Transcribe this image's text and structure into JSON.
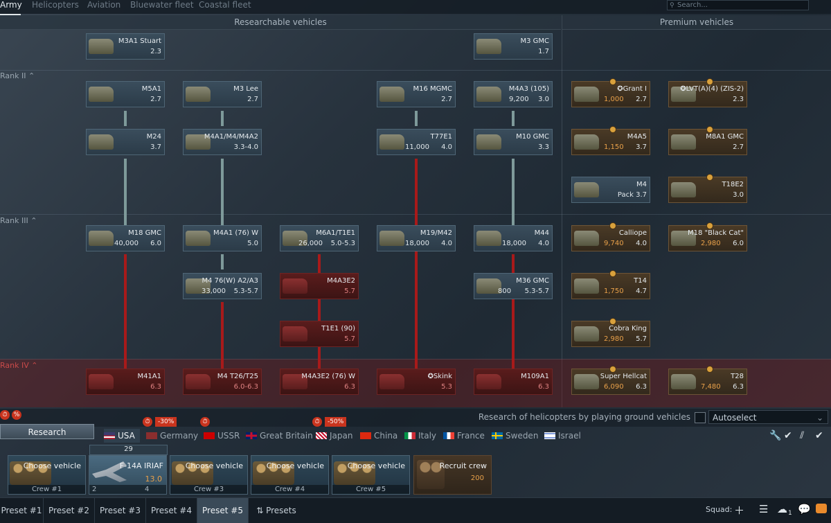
{
  "tabs": [
    "Army",
    "Helicopters",
    "Aviation",
    "Bluewater fleet",
    "Coastal fleet"
  ],
  "search_placeholder": "Search...",
  "sections": {
    "researchable": "Researchable vehicles",
    "premium": "Premium vehicles"
  },
  "ranks": [
    "Rank II",
    "Rank III",
    "Rank IV"
  ],
  "vehicles": {
    "m3a1": {
      "name": "M3A1 Stuart",
      "br": "2.3"
    },
    "m3gmc": {
      "name": "M3 GMC",
      "br": "1.7"
    },
    "m5a1": {
      "name": "M5A1",
      "br": "2.7"
    },
    "m3lee": {
      "name": "M3 Lee",
      "br": "2.7"
    },
    "m16": {
      "name": "M16 MGMC",
      "br": "2.7"
    },
    "m4a3105": {
      "name": "M4A3 (105)",
      "cost": "9,200",
      "br": "3.0"
    },
    "m24": {
      "name": "M24",
      "br": "3.7"
    },
    "m4a1": {
      "name": "M4A1/M4/M4A2",
      "br": "3.3-4.0"
    },
    "t77e1": {
      "name": "T77E1",
      "cost": "11,000",
      "br": "4.0"
    },
    "m10": {
      "name": "M10 GMC",
      "br": "3.3"
    },
    "m18": {
      "name": "M18 GMC",
      "cost": "40,000",
      "br": "6.0"
    },
    "m4a176": {
      "name": "M4A1 (76) W",
      "br": "5.0"
    },
    "m6a1": {
      "name": "M6A1/T1E1",
      "cost": "26,000",
      "br": "5.0-5.3"
    },
    "m19": {
      "name": "M19/M42",
      "cost": "18,000",
      "br": "4.0"
    },
    "m44": {
      "name": "M44",
      "cost": "18,000",
      "br": "4.0"
    },
    "m476w": {
      "name": "M4 76(W) A2/A3",
      "cost": "33,000",
      "br": "5.3-5.7"
    },
    "m4a3e2": {
      "name": "M4A3E2",
      "br": "5.7"
    },
    "m36": {
      "name": "M36 GMC",
      "cost": "800",
      "br": "5.3-5.7"
    },
    "t1e1": {
      "name": "T1E1 (90)",
      "br": "5.7"
    },
    "m41a1": {
      "name": "M41A1",
      "br": "6.3"
    },
    "m4t26": {
      "name": "M4 T26/T25",
      "br": "6.0-6.3"
    },
    "m4a3e276": {
      "name": "M4A3E2 (76) W",
      "br": "6.3"
    },
    "skink": {
      "name": "✪Skink",
      "br": "5.3"
    },
    "m109": {
      "name": "M109A1",
      "br": "6.3"
    }
  },
  "premium": {
    "granti": {
      "name": "✪Grant I",
      "price": "1,000",
      "br": "2.7"
    },
    "lvt": {
      "name": "✪LVT(A)(4) (ZIS-2)",
      "br": "2.3"
    },
    "m4a5": {
      "name": "M4A5",
      "price": "1,150",
      "br": "3.7"
    },
    "m8a1": {
      "name": "M8A1 GMC",
      "br": "2.7"
    },
    "m4pack": {
      "name": "M4",
      "br": "Pack 3.7"
    },
    "t18e2": {
      "name": "T18E2",
      "br": "3.0"
    },
    "calliope": {
      "name": "Calliope",
      "price": "9,740",
      "br": "4.0"
    },
    "blackcat": {
      "name": "M18 \"Black Cat\"",
      "price": "2,980",
      "br": "6.0"
    },
    "t14": {
      "name": "T14",
      "price": "1,750",
      "br": "4.7"
    },
    "cobra": {
      "name": "Cobra King",
      "price": "2,980",
      "br": "5.7"
    },
    "hellcat": {
      "name": "Super Hellcat",
      "price": "6,090",
      "br": "6.3"
    },
    "t28": {
      "name": "T28",
      "price": "7,480",
      "br": "6.3"
    }
  },
  "heli_research_text": "Research of helicopters by playing ground vehicles",
  "autoselect": "Autoselect",
  "research_button": "Research",
  "discounts": [
    "-30%",
    "-50%"
  ],
  "nations": [
    "USA",
    "Germany",
    "USSR",
    "Great Britain",
    "Japan",
    "China",
    "Italy",
    "France",
    "Sweden",
    "Israel"
  ],
  "crews": [
    {
      "vehicle": "Choose vehicle",
      "label": "Crew #1"
    },
    {
      "vehicle": "F-14A IRIAF",
      "br": "13.0",
      "top": "29",
      "left": "2",
      "right": "4",
      "label": ""
    },
    {
      "vehicle": "Choose vehicle",
      "label": "Crew #3"
    },
    {
      "vehicle": "Choose vehicle",
      "label": "Crew #4"
    },
    {
      "vehicle": "Choose vehicle",
      "label": "Crew #5"
    }
  ],
  "recruit": {
    "label": "Recruit crew",
    "price": "200"
  },
  "presets": [
    "Preset #1",
    "Preset #2",
    "Preset #3",
    "Preset #4",
    "Preset #5"
  ],
  "presets_button": "Presets",
  "squad_label": "Squad:",
  "notif_count": "1",
  "colors": {
    "locked": "#a81a1a",
    "premium_price": "#e9a14a",
    "accent": "#e98a2c"
  }
}
